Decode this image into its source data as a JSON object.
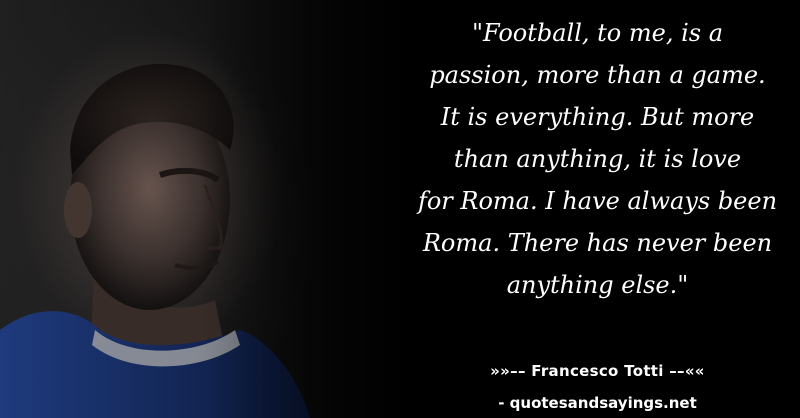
{
  "quote": {
    "text": "\"Football, to me, is a\npassion, more than a game.\nIt is everything. But more\nthan anything, it is love\nfor Roma. I have always been\nRoma. There has never been\nanything else.\""
  },
  "author": {
    "text": "»»–– Francesco Totti ––««"
  },
  "source": {
    "text": "- quotesandsayings.net"
  },
  "colors": {
    "background": "#000000",
    "text": "#ffffff",
    "jersey": "#1f3f8f"
  }
}
